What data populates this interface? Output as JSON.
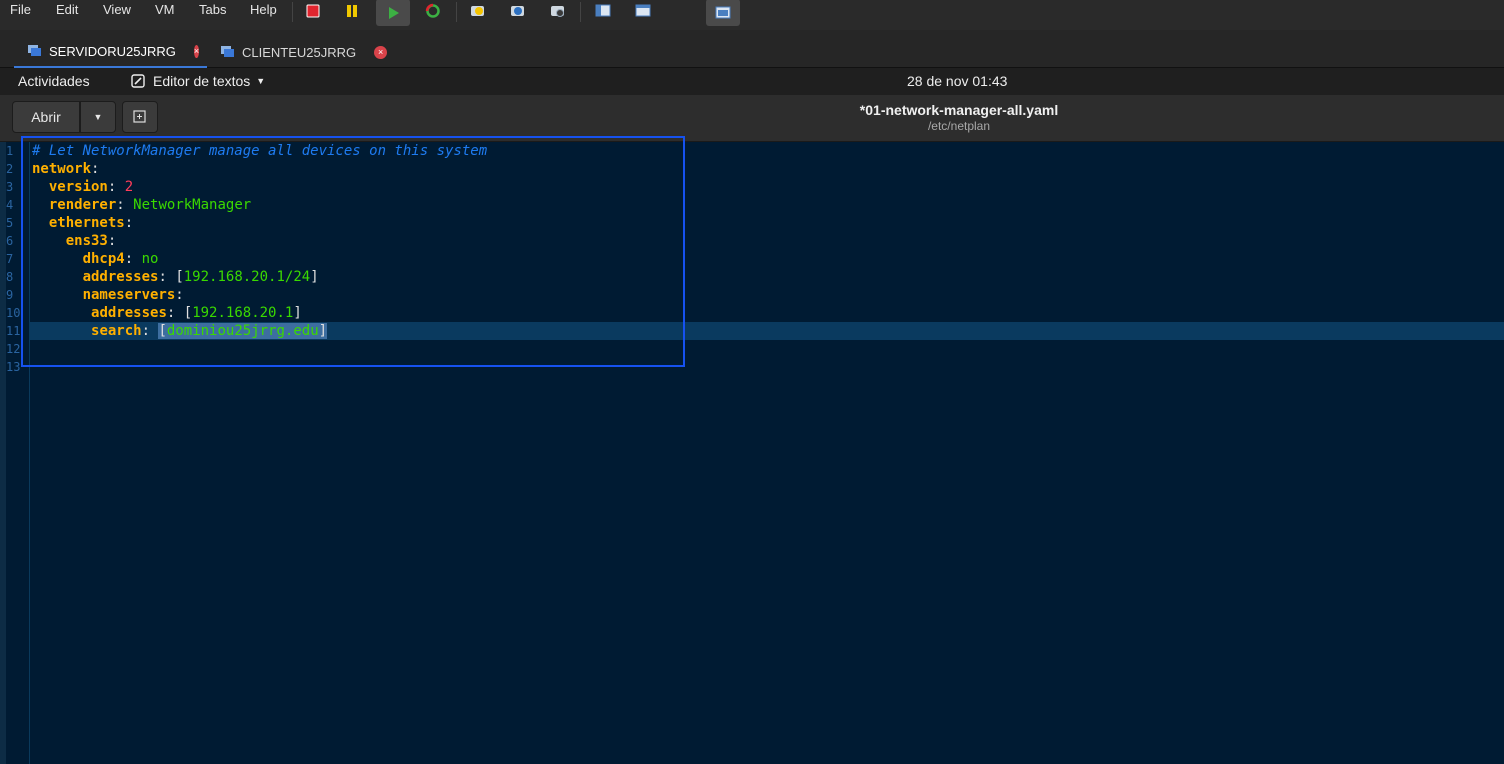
{
  "vm_menu": [
    "File",
    "Edit",
    "View",
    "VM",
    "Tabs",
    "Help"
  ],
  "vm_toolbar_icons": [
    "stop-icon",
    "pause-icon",
    "play-icon",
    "restart-icon",
    "snapshot-icon",
    "revert-snapshot-icon",
    "manage-snapshots-icon",
    "console-view-icon",
    "fullscreen-icon",
    "unity-icon"
  ],
  "vm_tabs": [
    {
      "label": "SERVIDORU25JRRG",
      "active": true
    },
    {
      "label": "CLIENTEU25JRRG",
      "active": false
    }
  ],
  "gnome": {
    "activities": "Actividades",
    "app_name": "Editor de textos",
    "clock": "28 de nov  01:43"
  },
  "header": {
    "open_label": "Abrir",
    "title": "*01-network-manager-all.yaml",
    "subtitle": "/etc/netplan"
  },
  "editor": {
    "line_numbers": [
      "1",
      "2",
      "3",
      "4",
      "5",
      "6",
      "7",
      "8",
      "9",
      "10",
      "11",
      "12",
      "13"
    ],
    "current_line": 11,
    "lines": [
      "# Let NetworkManager manage all devices on this system",
      "network:",
      "  version: 2",
      "  renderer: NetworkManager",
      "  ethernets:",
      "    ens33:",
      "      dhcp4: no",
      "      addresses: [192.168.20.1/24]",
      "      nameservers:",
      "       addresses: [192.168.20.1]",
      "       search: [dominiou25jrrg.edu]",
      "",
      ""
    ]
  },
  "colors": {
    "editor_bg": "#001b33",
    "key": "#ffb000",
    "string": "#3ad900",
    "number": "#ff3c5a",
    "comment": "#1e7bf0",
    "annotation_box": "#1652f0"
  }
}
